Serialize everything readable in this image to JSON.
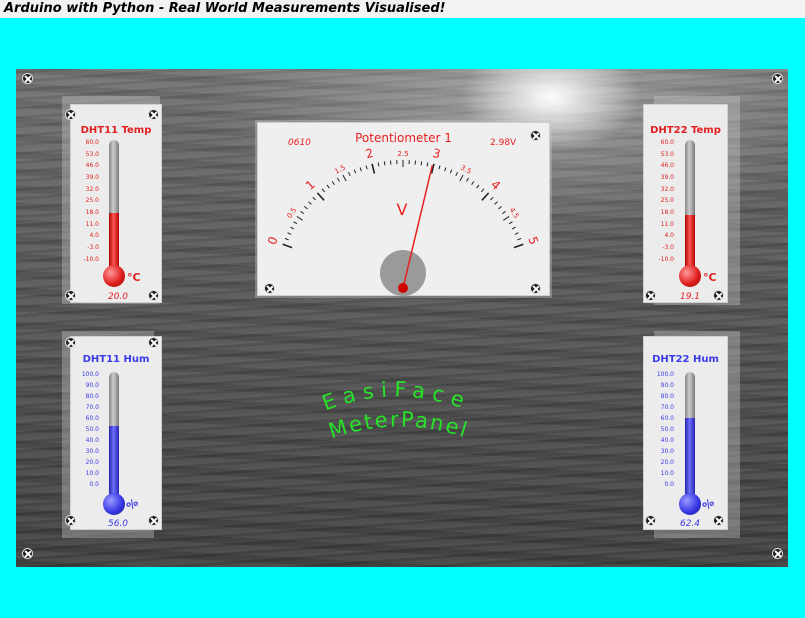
{
  "window": {
    "title": "Arduino with Python - Real World Measurements Visualised!"
  },
  "colors": {
    "background": "#00ffff",
    "temperature": "#e02020",
    "humidity": "#3a3ae8",
    "logo": "#27e327"
  },
  "meter": {
    "title": "Potentiometer 1",
    "serial": "0610",
    "reading": "2.98V",
    "unit_label": "V",
    "value": 2.98,
    "range": [
      0,
      5
    ],
    "major_labels": [
      "0",
      "1",
      "2",
      "3",
      "4",
      "5"
    ],
    "minor_labels": [
      "0.5",
      "1.5",
      "2.5",
      "3.5",
      "4.5"
    ]
  },
  "temp_scale": [
    "60.0",
    "53.0",
    "46.0",
    "39.0",
    "32.0",
    "25.0",
    "18.0",
    "11.0",
    "4.0",
    "-3.0",
    "-10.0"
  ],
  "hum_scale": [
    "100.0",
    "90.0",
    "80.0",
    "70.0",
    "60.0",
    "50.0",
    "40.0",
    "30.0",
    "20.0",
    "10.0",
    "0.0"
  ],
  "gauges": {
    "dht11_temp": {
      "title": "DHT11 Temp",
      "unit": "°C",
      "reading": "20.0",
      "value": 20.0,
      "range": [
        -10,
        60
      ],
      "icon": "thermometer-icon"
    },
    "dht22_temp": {
      "title": "DHT22 Temp",
      "unit": "°C",
      "reading": "19.1",
      "value": 19.1,
      "range": [
        -10,
        60
      ],
      "icon": "thermometer-icon"
    },
    "dht11_hum": {
      "title": "DHT11 Hum",
      "unit": "%",
      "reading": "56.0",
      "value": 56.0,
      "range": [
        0,
        100
      ],
      "icon": "thermometer-icon"
    },
    "dht22_hum": {
      "title": "DHT22 Hum",
      "unit": "%",
      "reading": "62.4",
      "value": 62.4,
      "range": [
        0,
        100
      ],
      "icon": "thermometer-icon"
    }
  },
  "logo": {
    "line1": "EasiFace",
    "line2": "MeterPanel"
  }
}
